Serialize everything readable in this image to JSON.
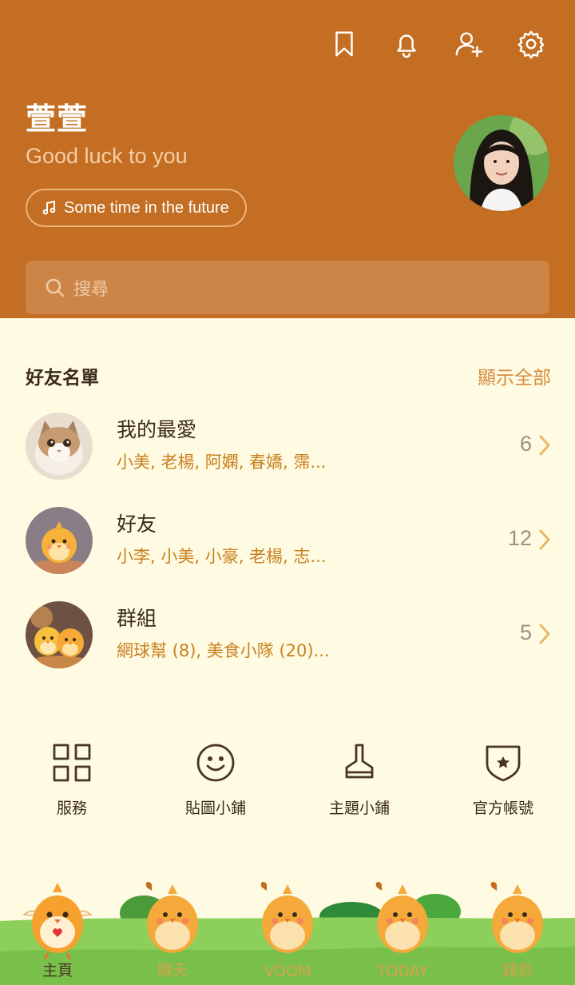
{
  "header": {
    "icons": [
      "bookmark-icon",
      "bell-icon",
      "add-friend-icon",
      "gear-icon"
    ],
    "name": "萱萱",
    "status_message": "Good luck to you",
    "music": "Some time in the future",
    "search_placeholder": "搜尋"
  },
  "friends_section": {
    "title": "好友名單",
    "show_all": "顯示全部",
    "rows": [
      {
        "title": "我的最愛",
        "subtitle": "小美, 老楊, 阿嫻, 春嬌, 霈...",
        "count": "6"
      },
      {
        "title": "好友",
        "subtitle": "小李, 小美, 小豪, 老楊, 志...",
        "count": "12"
      },
      {
        "title": "群組",
        "subtitle": "網球幫 (8), 美食小隊 (20)...",
        "count": "5"
      }
    ]
  },
  "quick_actions": [
    {
      "label": "服務",
      "icon": "grid-icon"
    },
    {
      "label": "貼圖小鋪",
      "icon": "smiley-icon"
    },
    {
      "label": "主題小鋪",
      "icon": "brush-icon"
    },
    {
      "label": "官方帳號",
      "icon": "shield-star-icon"
    }
  ],
  "bottom_nav": [
    {
      "label": "主頁",
      "active": true
    },
    {
      "label": "聊天",
      "active": false
    },
    {
      "label": "VOOM",
      "active": false
    },
    {
      "label": "TODAY",
      "active": false
    },
    {
      "label": "錢包",
      "active": false
    }
  ],
  "colors": {
    "header_bg": "#c36e22",
    "page_bg": "#fffbe3",
    "accent": "#c9801f",
    "text_dark": "#3c2a1c"
  }
}
